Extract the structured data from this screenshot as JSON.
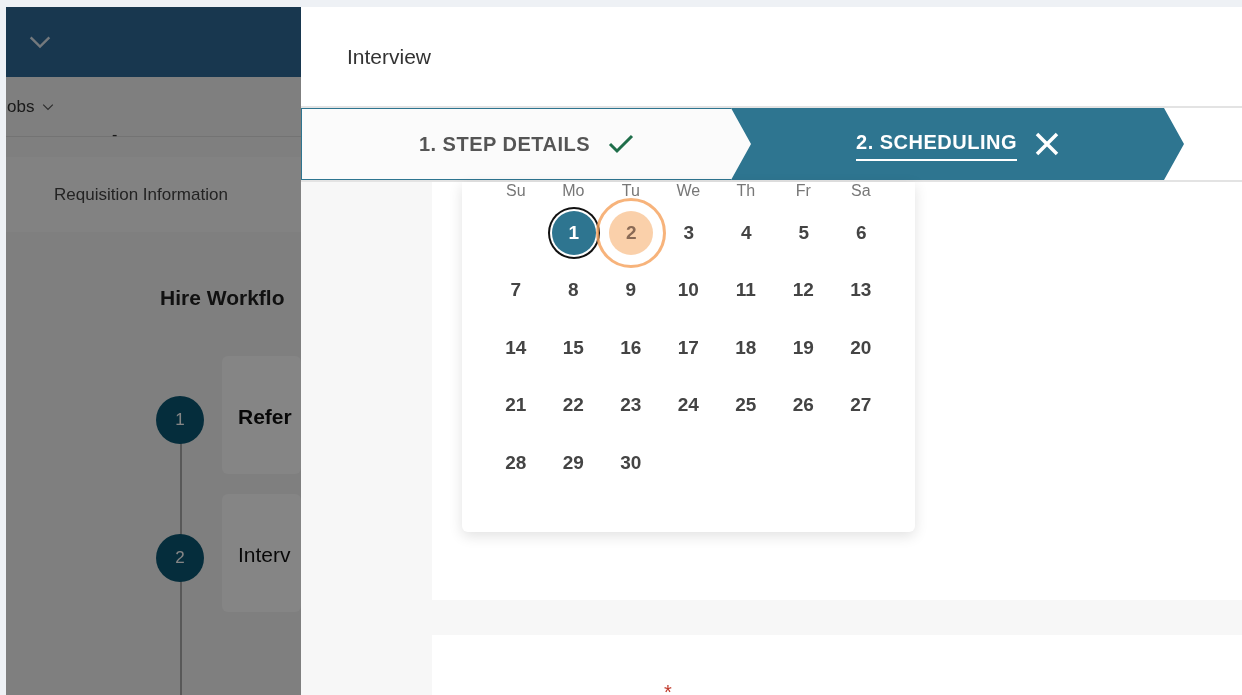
{
  "background_page": {
    "nav": {
      "label": "obs"
    },
    "dash": "-",
    "tab": {
      "label": "Requisition Information"
    },
    "section_title": "Hire Workflo",
    "workflow_steps": [
      {
        "number": "1",
        "title": "Refer"
      },
      {
        "number": "2",
        "title": "Interv"
      }
    ]
  },
  "modal": {
    "title": "Interview",
    "stepper": [
      {
        "label": "1. STEP DETAILS",
        "kind": "check",
        "selected": false
      },
      {
        "label": "2. SCHEDULING",
        "kind": "cross",
        "selected": true
      }
    ],
    "calendar": {
      "weekdays": [
        "Su",
        "Mo",
        "Tu",
        "We",
        "Th",
        "Fr",
        "Sa"
      ],
      "weeks": [
        [
          {
            "day": "1",
            "selected": true,
            "highlighted": false
          },
          {
            "day": "2",
            "selected": false,
            "highlighted": true
          },
          {
            "day": "3",
            "selected": false,
            "highlighted": false
          },
          {
            "day": "4",
            "selected": false,
            "highlighted": false
          },
          {
            "day": "5",
            "selected": false,
            "highlighted": false
          },
          {
            "day": "6",
            "selected": false,
            "highlighted": false
          }
        ],
        [
          {
            "day": "7",
            "selected": false,
            "highlighted": false
          },
          {
            "day": "8",
            "selected": false,
            "highlighted": false
          },
          {
            "day": "9",
            "selected": false,
            "highlighted": false
          },
          {
            "day": "10",
            "selected": false,
            "highlighted": false
          },
          {
            "day": "11",
            "selected": false,
            "highlighted": false
          },
          {
            "day": "12",
            "selected": false,
            "highlighted": false
          },
          {
            "day": "13",
            "selected": false,
            "highlighted": false
          }
        ],
        [
          {
            "day": "14",
            "selected": false,
            "highlighted": false
          },
          {
            "day": "15",
            "selected": false,
            "highlighted": false
          },
          {
            "day": "16",
            "selected": false,
            "highlighted": false
          },
          {
            "day": "17",
            "selected": false,
            "highlighted": false
          },
          {
            "day": "18",
            "selected": false,
            "highlighted": false
          },
          {
            "day": "19",
            "selected": false,
            "highlighted": false
          },
          {
            "day": "20",
            "selected": false,
            "highlighted": false
          }
        ],
        [
          {
            "day": "21",
            "selected": false,
            "highlighted": false
          },
          {
            "day": "22",
            "selected": false,
            "highlighted": false
          },
          {
            "day": "23",
            "selected": false,
            "highlighted": false
          },
          {
            "day": "24",
            "selected": false,
            "highlighted": false
          },
          {
            "day": "25",
            "selected": false,
            "highlighted": false
          },
          {
            "day": "26",
            "selected": false,
            "highlighted": false
          },
          {
            "day": "27",
            "selected": false,
            "highlighted": false
          }
        ],
        [
          {
            "day": "28",
            "selected": false,
            "highlighted": false
          },
          {
            "day": "29",
            "selected": false,
            "highlighted": false
          },
          {
            "day": "30",
            "selected": false,
            "highlighted": false
          }
        ]
      ]
    },
    "required_mark": "*"
  }
}
